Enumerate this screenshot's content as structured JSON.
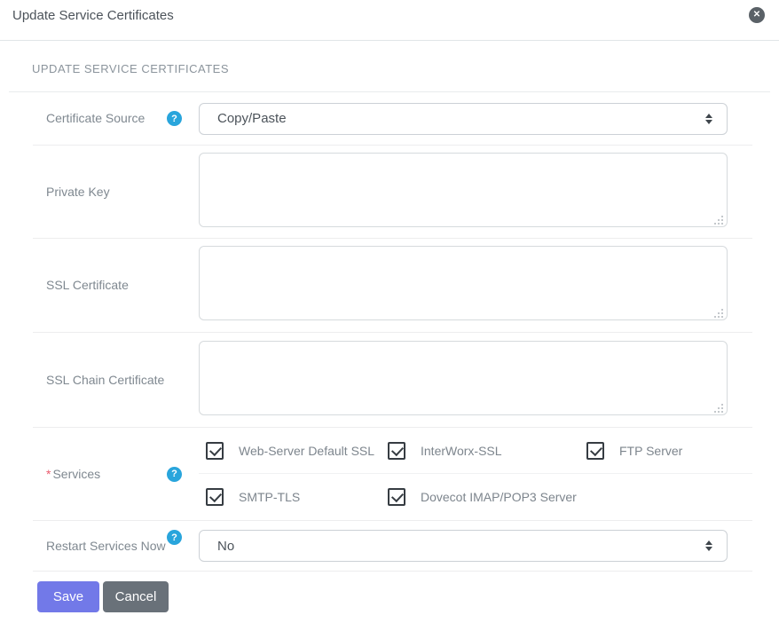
{
  "header": {
    "title": "Update Service Certificates"
  },
  "section": {
    "heading": "UPDATE SERVICE CERTIFICATES"
  },
  "form": {
    "certificate_source": {
      "label": "Certificate Source",
      "value": "Copy/Paste"
    },
    "private_key": {
      "label": "Private Key",
      "value": ""
    },
    "ssl_certificate": {
      "label": "SSL Certificate",
      "value": ""
    },
    "ssl_chain_certificate": {
      "label": "SSL Chain Certificate",
      "value": ""
    },
    "services": {
      "label": "Services",
      "required_marker": "*",
      "items": [
        {
          "label": "Web-Server Default SSL",
          "checked": true
        },
        {
          "label": "InterWorx-SSL",
          "checked": true
        },
        {
          "label": "FTP Server",
          "checked": true
        },
        {
          "label": "SMTP-TLS",
          "checked": true
        },
        {
          "label": "Dovecot IMAP/POP3 Server",
          "checked": true
        }
      ]
    },
    "restart_services_now": {
      "label": "Restart Services Now",
      "value": "No"
    }
  },
  "actions": {
    "save_label": "Save",
    "cancel_label": "Cancel"
  },
  "icons": {
    "close": "x-circle",
    "help": "question-circle",
    "select_arrows": "up-down-arrows",
    "resize_grip": "dotted-resize-grip"
  },
  "colors": {
    "save_button": "#7279e8",
    "cancel_button": "#697179",
    "help_icon": "#29a5dc",
    "required_marker": "#ea5b6e",
    "close_icon_bg": "#5a6167"
  }
}
